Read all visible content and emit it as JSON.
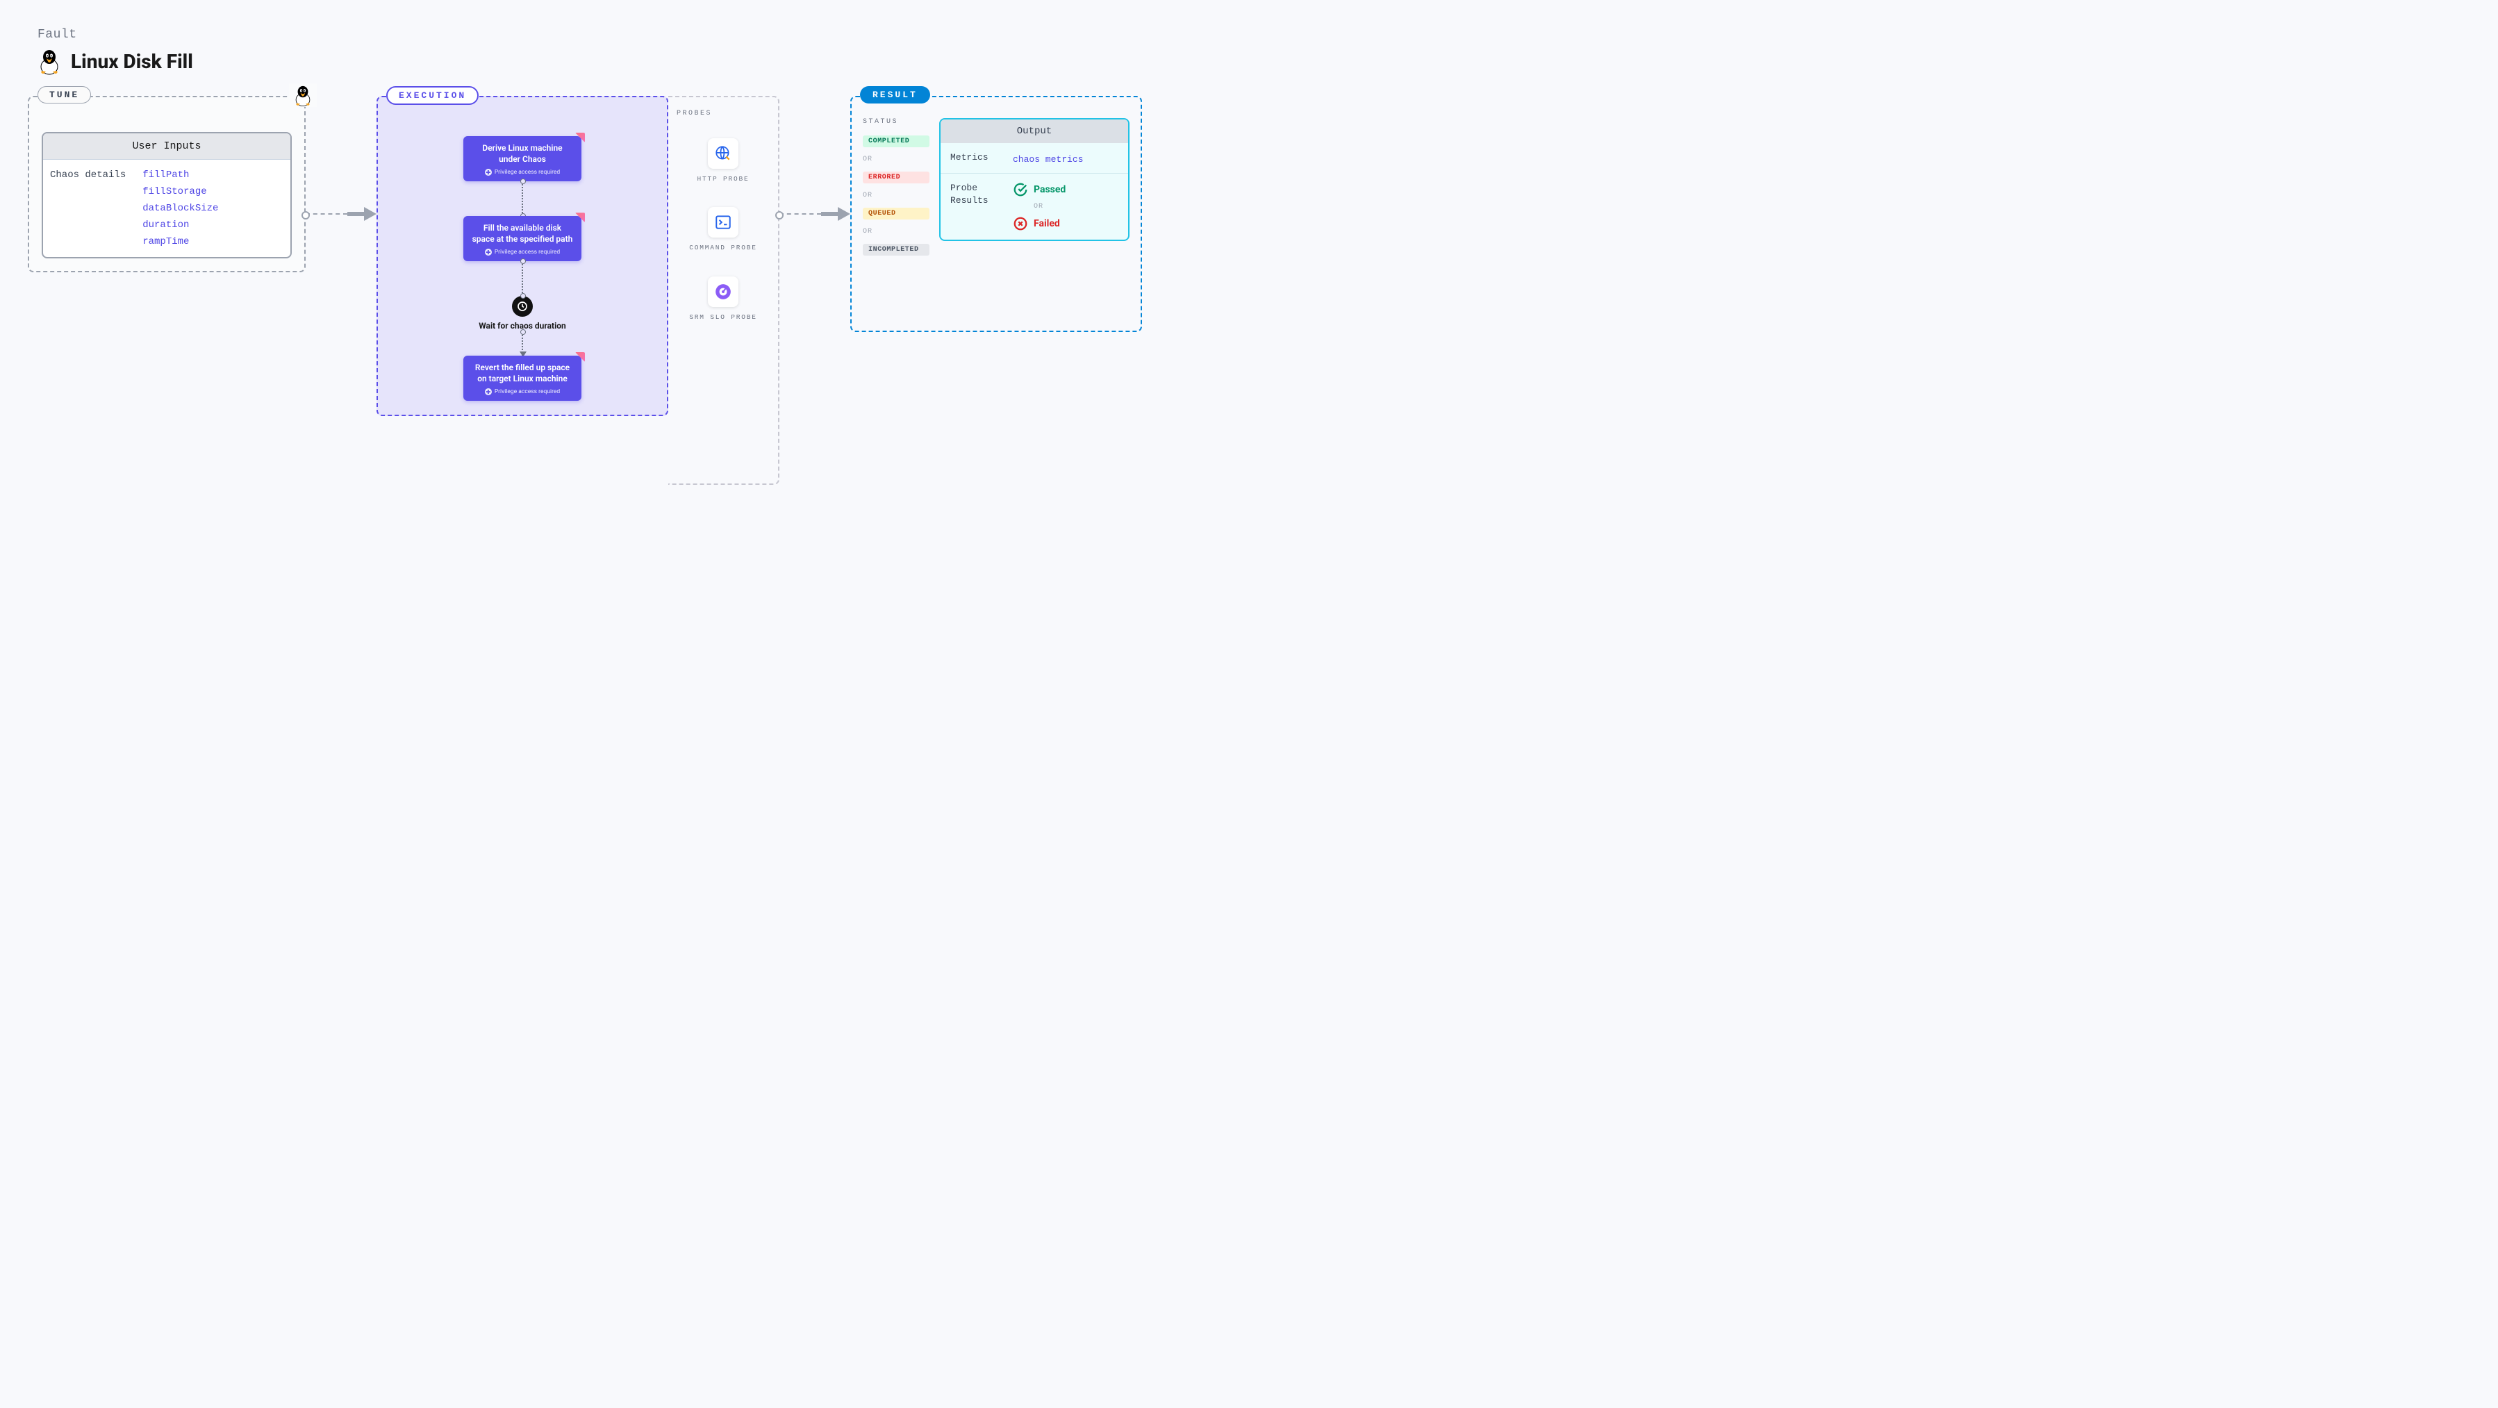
{
  "header": {
    "fault_label": "Fault",
    "title": "Linux Disk Fill"
  },
  "tune": {
    "pill": "TUNE",
    "card_title": "User Inputs",
    "section_label": "Chaos details",
    "params": [
      "fillPath",
      "fillStorage",
      "dataBlockSize",
      "duration",
      "rampTime"
    ]
  },
  "execution": {
    "pill": "EXECUTION",
    "privilege_text": "Privilege access required",
    "steps": [
      {
        "title": "Derive Linux machine under Chaos",
        "priv": true
      },
      {
        "title": "Fill the available disk space at the specified path",
        "priv": true
      },
      {
        "title": "Wait for chaos duration",
        "wait": true
      },
      {
        "title": "Revert the filled up space on target Linux machine",
        "priv": true
      }
    ]
  },
  "probes": {
    "label": "PROBES",
    "items": [
      {
        "name": "HTTP PROBE",
        "icon": "globe"
      },
      {
        "name": "COMMAND PROBE",
        "icon": "terminal"
      },
      {
        "name": "SRM SLO PROBE",
        "icon": "gauge"
      }
    ]
  },
  "result": {
    "pill": "RESULT",
    "status_label": "STATUS",
    "or": "OR",
    "statuses": [
      "COMPLETED",
      "ERRORED",
      "QUEUED",
      "INCOMPLETED"
    ],
    "output": {
      "title": "Output",
      "metrics_key": "Metrics",
      "metrics_val": "chaos metrics",
      "probe_key": "Probe Results",
      "passed": "Passed",
      "failed": "Failed"
    }
  }
}
